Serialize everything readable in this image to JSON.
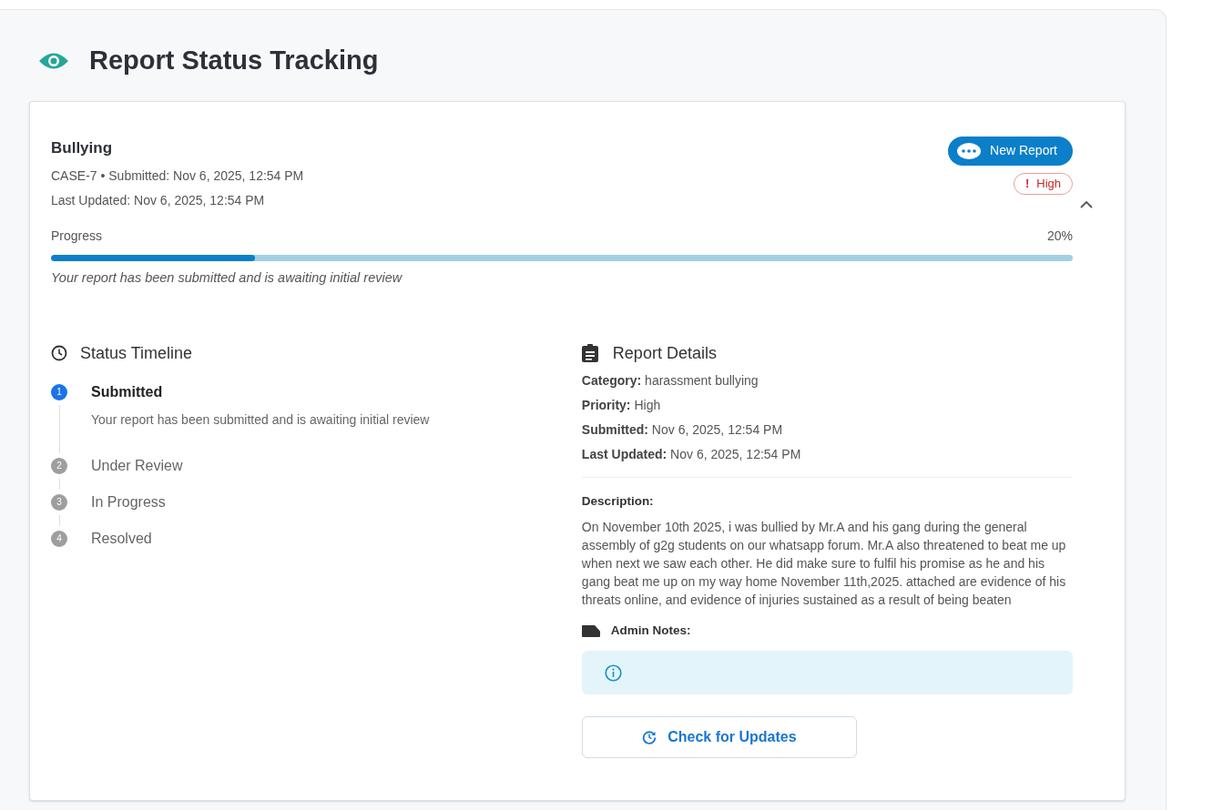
{
  "page_title": "Report Status Tracking",
  "report": {
    "title": "Bullying",
    "meta": "CASE-7 • Submitted: Nov 6, 2025, 12:54 PM",
    "last_updated": "Last Updated: Nov 6, 2025, 12:54 PM",
    "new_report_button": "New Report",
    "priority_badge": {
      "icon": "!",
      "label": "High"
    },
    "expanded": true,
    "progress": {
      "label": "Progress",
      "reading": "20%",
      "level": 0.2,
      "message": "Your report has been submitted and is awaiting initial review"
    }
  },
  "timeline": {
    "title": "Status Timeline",
    "steps": [
      {
        "number": "1",
        "label": "Submitted",
        "active": true,
        "description": "Your report has been submitted and is awaiting initial review"
      },
      {
        "number": "2",
        "label": "Under Review",
        "active": false
      },
      {
        "number": "3",
        "label": "In Progress",
        "active": false
      },
      {
        "number": "4",
        "label": "Resolved",
        "active": false
      }
    ]
  },
  "details": {
    "title": "Report Details",
    "fields": [
      "**Category:** harassment bullying",
      "**Priority:** High",
      "**Submitted:** Nov 6, 2025, 12:54 PM",
      "**Last Updated:** Nov 6, 2025, 12:54 PM"
    ],
    "description_label": "Description:",
    "description": "On November 10th 2025, i was bullied by Mr.A and his gang during the general assembly of g2g students on our whatsapp forum. Mr.A also threatened to beat me up when next we saw each other. He did make sure to fulfil his promise as he and his gang beat me up on my way home November 11th,2025. attached are evidence of his threats online, and evidence of injuries sustained as a result of being beaten",
    "admin_notes_label": "Admin Notes:",
    "check_button": "Check for Updates"
  }
}
